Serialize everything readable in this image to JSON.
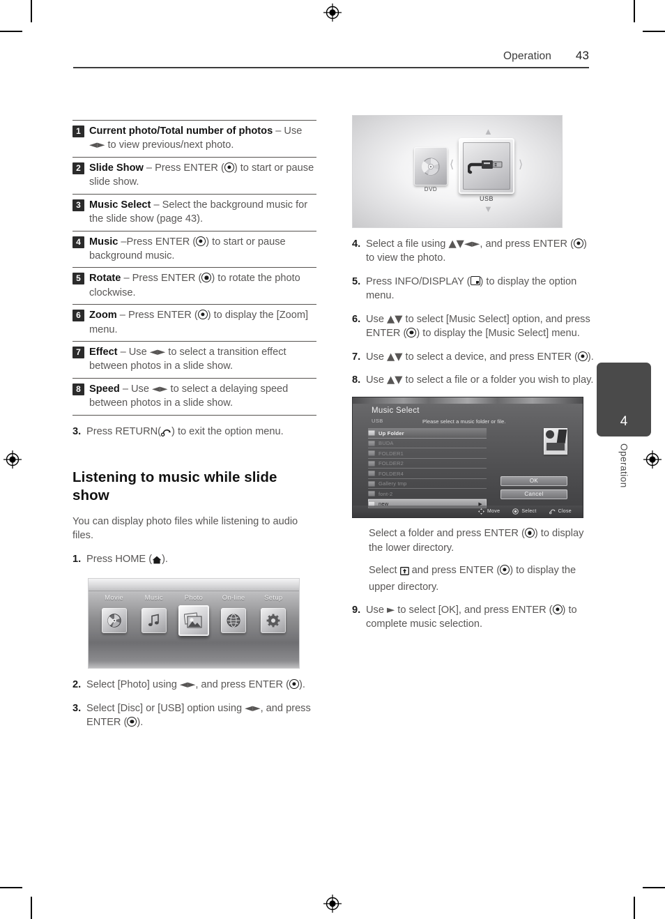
{
  "page": {
    "header": {
      "section": "Operation",
      "number": "43"
    },
    "side_tab": {
      "chapter": "4",
      "label": "Operation"
    }
  },
  "features": {
    "rows": [
      {
        "num": "1",
        "title": "Current photo/Total number of photos",
        "desc_pre": " – Use ",
        "icon": "left-right-arrows",
        "desc_post": " to view previous/next photo."
      },
      {
        "num": "2",
        "title": "Slide Show",
        "desc_pre": " – Press ENTER (",
        "icon": "enter-button",
        "desc_post": ") to start or pause slide show."
      },
      {
        "num": "3",
        "title": "Music Select",
        "desc_pre": " – Select the background music for the slide show (page 43).",
        "icon": "",
        "desc_post": ""
      },
      {
        "num": "4",
        "title": "Music",
        "desc_pre": " –Press ENTER (",
        "icon": "enter-button",
        "desc_post": ") to start or pause background music."
      },
      {
        "num": "5",
        "title": "Rotate",
        "desc_pre": " – Press ENTER (",
        "icon": "enter-button",
        "desc_post": ") to rotate the photo clockwise."
      },
      {
        "num": "6",
        "title": "Zoom",
        "desc_pre": " – Press ENTER (",
        "icon": "enter-button",
        "desc_post": ") to display the [Zoom] menu."
      },
      {
        "num": "7",
        "title": "Effect",
        "desc_pre": " – Use ",
        "icon": "left-right-arrows",
        "desc_post": " to select a transition effect between photos in a slide show."
      },
      {
        "num": "8",
        "title": "Speed",
        "desc_pre": " – Use ",
        "icon": "left-right-arrows",
        "desc_post": " to select a delaying speed between photos in a slide show."
      }
    ]
  },
  "left_column": {
    "step3": {
      "num": "3.",
      "pre": "Press RETURN(",
      "icon": "return-button",
      "post": ") to exit the option menu."
    },
    "section_title": "Listening to music while slide show",
    "lead": "You can display photo files while listening to audio files.",
    "step1": {
      "num": "1.",
      "pre": "Press HOME (",
      "icon": "home-button",
      "post": ")."
    },
    "home_menu": {
      "items": [
        {
          "label": "Movie",
          "icon": "movie-disc-icon",
          "selected": false
        },
        {
          "label": "Music",
          "icon": "music-note-icon",
          "selected": false
        },
        {
          "label": "Photo",
          "icon": "photo-icon",
          "selected": true
        },
        {
          "label": "On-line",
          "icon": "globe-icon",
          "selected": false
        },
        {
          "label": "Setup",
          "icon": "gear-icon",
          "selected": false
        }
      ]
    },
    "step2": {
      "num": "2.",
      "pre": "Select [Photo] using ",
      "icon": "left-right-arrows",
      "post": ", and press ENTER (",
      "icon2": "enter-button",
      "post2": ")."
    },
    "step3b": {
      "num": "3.",
      "pre": "Select [Disc] or [USB] option using ",
      "icon": "left-right-arrows",
      "post": ", and press ENTER (",
      "icon2": "enter-button",
      "post2": ")."
    }
  },
  "right_column": {
    "device_select": {
      "dvd_label": "DVD",
      "usb_label": "USB",
      "dvd_icon": "disc-icon",
      "usb_icon": "usb-plug-icon",
      "selected": "USB"
    },
    "step4": {
      "num": "4.",
      "pre": "Select a file using ",
      "icon": "four-way-arrows",
      "post": ", and press ENTER (",
      "icon2": "enter-button",
      "post2": ") to view the photo."
    },
    "step5": {
      "num": "5.",
      "pre": "Press INFO/DISPLAY (",
      "icon": "info-display-button",
      "post": ") to display the option menu."
    },
    "step6": {
      "num": "6.",
      "pre": "Use ",
      "icon": "up-down-arrows",
      "post": " to select [Music Select] option, and press ENTER (",
      "icon2": "enter-button",
      "post2": ") to display the [Music Select] menu."
    },
    "step7": {
      "num": "7.",
      "pre": "Use ",
      "icon": "up-down-arrows",
      "post": " to select a device, and press ENTER (",
      "icon2": "enter-button",
      "post2": ")."
    },
    "step8": {
      "num": "8.",
      "pre": "Use ",
      "icon": "up-down-arrows",
      "post": " to select a file or a folder you wish to play."
    },
    "music_select_dialog": {
      "title": "Music Select",
      "device": "USB",
      "hint": "Please select a music folder or file.",
      "rows": [
        {
          "label": "Up Folder",
          "state": "up"
        },
        {
          "label": "BUDA",
          "state": "dim"
        },
        {
          "label": "FOLDER1",
          "state": "dim"
        },
        {
          "label": "FOLDER2",
          "state": "dim"
        },
        {
          "label": "FOLDER4",
          "state": "dim"
        },
        {
          "label": "Gallery tmp",
          "state": "dim"
        },
        {
          "label": "font-2",
          "state": "dim"
        },
        {
          "label": "new",
          "state": "hl"
        }
      ],
      "buttons": {
        "ok": "OK",
        "cancel": "Cancel"
      },
      "bottom_bar": [
        {
          "label": "Move",
          "icon": "four-way-arrows-icon"
        },
        {
          "label": "Select",
          "icon": "enter-circle-icon"
        },
        {
          "label": "Close",
          "icon": "return-arrow-icon"
        }
      ]
    },
    "note1": {
      "pre": "Select a folder and press ENTER (",
      "icon": "enter-button",
      "post": ") to display the lower directory."
    },
    "note2": {
      "pre": "Select ",
      "icon": "up-folder-button",
      "mid": " and press ENTER (",
      "icon2": "enter-button",
      "post": ") to display the upper directory."
    },
    "step9": {
      "num": "9.",
      "pre": "Use ",
      "icon": "right-arrow",
      "post": " to select [OK], and press ENTER (",
      "icon2": "enter-button",
      "post2": ") to complete music selection."
    }
  }
}
